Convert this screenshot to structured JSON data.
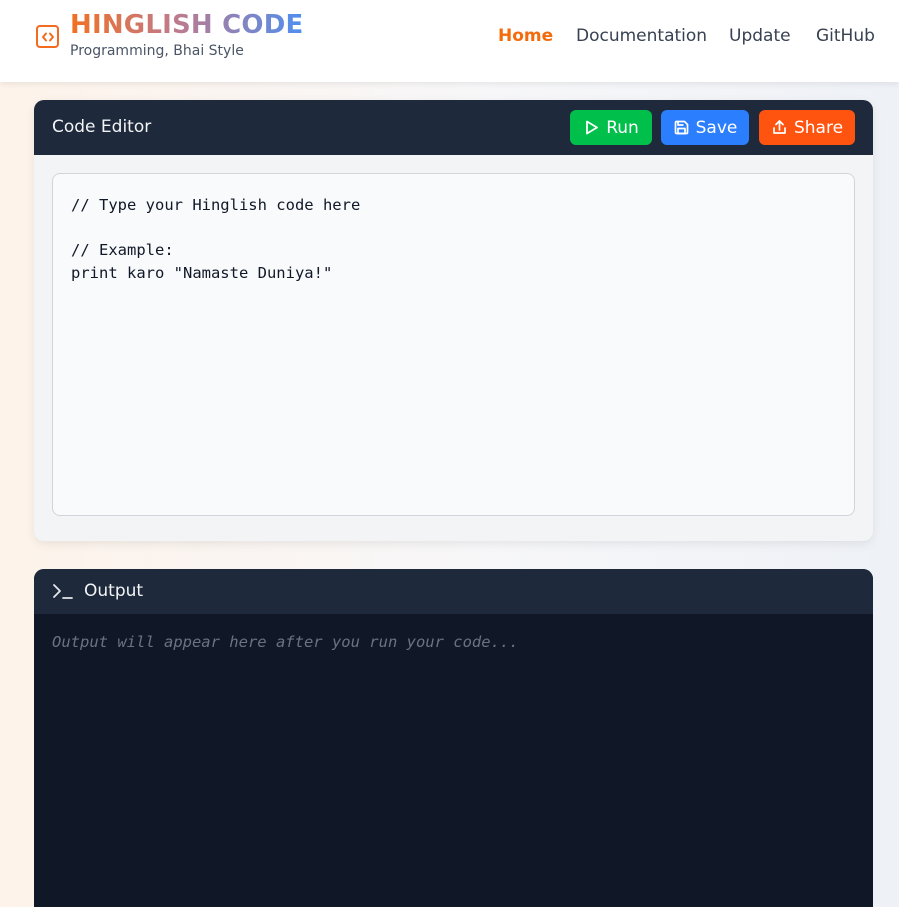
{
  "brand": {
    "title": "HINGLISH CODE",
    "tagline": "Programming, Bhai Style",
    "icon": "code-brackets-icon",
    "accent_color": "#f26b21"
  },
  "nav": {
    "items": [
      {
        "label": "Home",
        "active": true
      },
      {
        "label": "Documentation",
        "active": false
      },
      {
        "label": "Update",
        "active": false
      },
      {
        "label": "GitHub",
        "active": false
      }
    ]
  },
  "editor": {
    "title": "Code Editor",
    "buttons": {
      "run": {
        "label": "Run",
        "icon": "play-icon",
        "color": "#00c04b"
      },
      "save": {
        "label": "Save",
        "icon": "save-icon",
        "color": "#2b7fff"
      },
      "share": {
        "label": "Share",
        "icon": "share-icon",
        "color": "#ff5410"
      }
    },
    "code": "// Type your Hinglish code here\n\n// Example:\nprint karo \"Namaste Duniya!\""
  },
  "output": {
    "title": "Output",
    "icon": "terminal-icon",
    "placeholder": "Output will appear here after you run your code..."
  }
}
